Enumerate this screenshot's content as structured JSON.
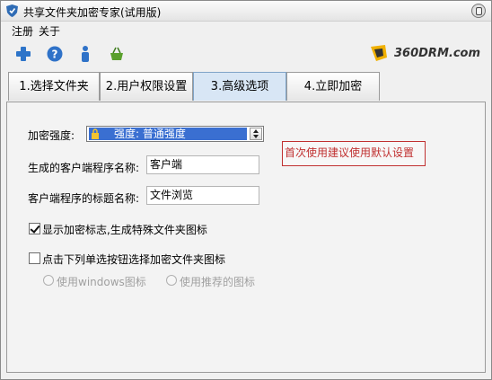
{
  "window": {
    "title": "共享文件夹加密专家(试用版)"
  },
  "menu": {
    "items": [
      "注册",
      "关于"
    ]
  },
  "toolbar": {
    "icons": [
      "add-icon",
      "help-icon",
      "info-icon",
      "shop-icon"
    ]
  },
  "brand": {
    "text": "360DRM.com"
  },
  "tabs": [
    {
      "label": "1.选择文件夹"
    },
    {
      "label": "2.用户权限设置"
    },
    {
      "label": "3.高级选项"
    },
    {
      "label": "4.立即加密"
    }
  ],
  "form": {
    "strength_label": "加密强度:",
    "strength_value": "强度: 普通强度",
    "client_name_label": "生成的客户端程序名称:",
    "client_name_value": "客户端",
    "client_title_label": "客户端程序的标题名称:",
    "client_title_value": "文件浏览",
    "show_mark_label": "显示加密标志,生成特殊文件夹图标",
    "show_mark_checked": true,
    "pick_icon_label": "点击下列单选按钮选择加密文件夹图标",
    "pick_icon_checked": false,
    "radio_windows_label": "使用windows图标",
    "radio_recommended_label": "使用推荐的图标"
  },
  "note": {
    "text": "首次使用建议使用默认设置"
  },
  "colors": {
    "accent": "#3a6fd1",
    "note": "#c03030"
  }
}
